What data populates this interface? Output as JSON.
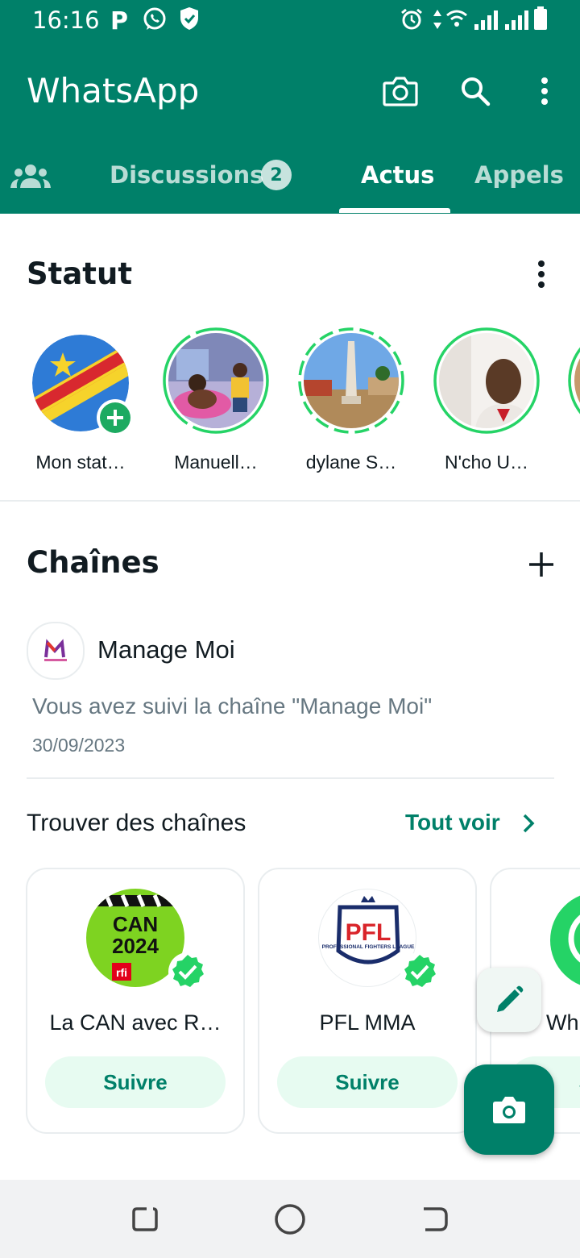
{
  "status_bar": {
    "time": "16:16",
    "left_icons": [
      "parking-icon",
      "whatsapp-icon",
      "shield-icon"
    ],
    "right_icons": [
      "alarm-icon",
      "data-arrows-icon",
      "wifi-icon",
      "signal-icon",
      "signal-icon",
      "battery-icon"
    ]
  },
  "header": {
    "title": "WhatsApp",
    "actions": [
      "camera-icon",
      "search-icon",
      "more-vertical-icon"
    ]
  },
  "tabs": {
    "community_icon": "community-icon",
    "items": [
      {
        "label": "Discussions",
        "badge": "2"
      },
      {
        "label": "Actus",
        "active": true
      },
      {
        "label": "Appels"
      }
    ]
  },
  "status_section": {
    "title": "Statut",
    "stories": [
      {
        "name": "Mon stat…"
      },
      {
        "name": "Manuell…"
      },
      {
        "name": "dylane S…"
      },
      {
        "name": "N'cho U…"
      }
    ]
  },
  "channels": {
    "title": "Chaînes",
    "followed": {
      "name": "Manage Moi",
      "message": "Vous avez suivi la chaîne \"Manage Moi\"",
      "date": "30/09/2023"
    },
    "find": {
      "title": "Trouver des chaînes",
      "see_all": "Tout voir",
      "cards": [
        {
          "name": "La CAN avec R…",
          "logo_lines": [
            "CAN",
            "2024"
          ],
          "logo_tag": "rfi",
          "follow": "Suivre"
        },
        {
          "name": "PFL MMA",
          "logo_text": "PFL",
          "logo_sub": "PROFESSIONAL FIGHTERS LEAGUE",
          "follow": "Suivre"
        },
        {
          "name": "Wh",
          "follow": "S"
        }
      ]
    }
  },
  "colors": {
    "header": "#008069",
    "accent_green": "#25d366",
    "follow_bg": "#e7fbf1",
    "fab": "#008069"
  },
  "fabs": [
    "pencil-icon",
    "camera-icon"
  ],
  "nav_bar": [
    "recent-apps-icon",
    "home-icon",
    "back-icon"
  ]
}
